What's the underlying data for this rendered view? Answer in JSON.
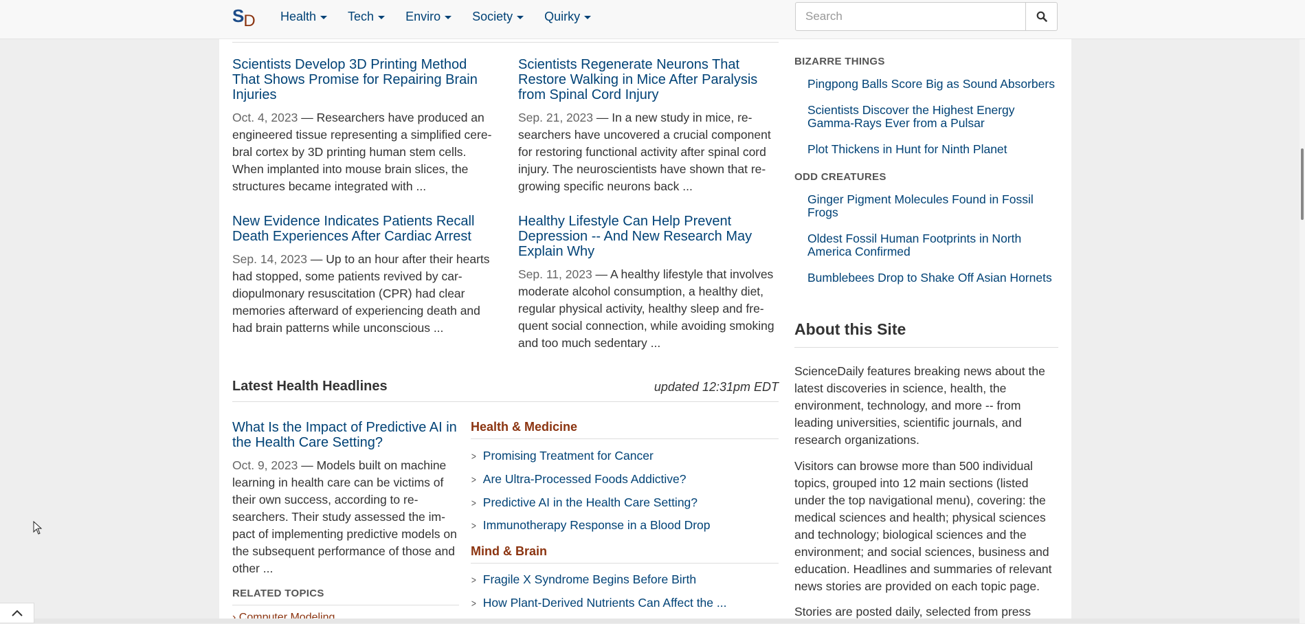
{
  "brand": {
    "s": "S",
    "d": "D"
  },
  "nav": [
    {
      "label": "Health"
    },
    {
      "label": "Tech"
    },
    {
      "label": "Enviro"
    },
    {
      "label": "Society"
    },
    {
      "label": "Quirky"
    }
  ],
  "search": {
    "placeholder": "Search",
    "icon": "search-icon"
  },
  "stories": [
    {
      "title": "Scientists Develop 3D Printing Method That Shows Promise for Repairing Brain Injuries",
      "date": "Oct. 4, 2023",
      "summary": "Researchers have produced an engineered tissue representing a simplified cere-bral cortex by 3D printing human stem cells. When implanted into mouse brain slices, the structures became integrated with ..."
    },
    {
      "title": "Scientists Regenerate Neurons That Restore Walking in Mice After Paralysis from Spinal Cord Injury",
      "date": "Sep. 21, 2023",
      "summary": "In a new study in mice, re-searchers have uncovered a crucial component for restoring functional activity after spinal cord injury. The neuroscientists have shown that re-growing specific neurons back ..."
    },
    {
      "title": "New Evidence Indicates Patients Recall Death Experiences After Cardiac Arrest",
      "date": "Sep. 14, 2023",
      "summary": "Up to an hour after their hearts had stopped, some patients revived by car-diopulmonary resuscitation (CPR) had clear memories afterward of experiencing death and had brain patterns while unconscious ..."
    },
    {
      "title": "Healthy Lifestyle Can Help Prevent Depression -- And New Research May Explain Why",
      "date": "Sep. 11, 2023",
      "summary": "A healthy lifestyle that involves moderate alcohol consumption, a healthy diet, regular physical activity, healthy sleep and fre-quent social connection, while avoiding smoking and too much sedentary ..."
    }
  ],
  "latest": {
    "heading": "Latest Health Headlines",
    "updated": "updated 12:31pm EDT",
    "feature": {
      "title": "What Is the Impact of Predictive AI in the Health Care Setting?",
      "date": "Oct. 9, 2023",
      "summary": "Models built on machine learning in health care can be victims of their own success, according to re-searchers. Their study assessed the im-pact of implementing predictive models on the subsequent performance of those and other ..."
    },
    "related_label": "RELATED TOPICS",
    "related_first": "Computer Modeling",
    "categories": [
      {
        "name": "Health & Medicine",
        "items": [
          "Promising Treatment for Cancer",
          "Are Ultra-Processed Foods Addictive?",
          "Predictive AI in the Health Care Setting?",
          "Immunotherapy Response in a Blood Drop"
        ]
      },
      {
        "name": "Mind & Brain",
        "items": [
          "Fragile X Syndrome Begins Before Birth",
          "How Plant-Derived Nutrients Can Affect the ..."
        ]
      }
    ]
  },
  "sidebar": {
    "bizarre_label": "BIZARRE THINGS",
    "bizarre": [
      "Pingpong Balls Score Big as Sound Absorbers",
      "Scientists Discover the Highest Energy Gamma-Rays Ever from a Pulsar",
      "Plot Thickens in Hunt for Ninth Planet"
    ],
    "odd_label": "ODD CREATURES",
    "odd": [
      "Ginger Pigment Molecules Found in Fossil Frogs",
      "Oldest Fossil Human Footprints in North America Confirmed",
      "Bumblebees Drop to Shake Off Asian Hornets"
    ],
    "about_heading": "About this Site",
    "about_p1": "ScienceDaily features breaking news about the latest discoveries in science, health, the environment, technology, and more -- from leading universities, scientific journals, and research organizations.",
    "about_p2": "Visitors can browse more than 500 individual topics, grouped into 12 main sections (listed under the top navigational menu), covering: the medical sciences and health; physical sciences and technology; biological sciences and the environment; and social sciences, business and education. Headlines and summaries of relevant news stories are provided on each topic page.",
    "about_p3": "Stories are posted daily, selected from press"
  },
  "colors": {
    "link": "#004276",
    "category": "#8b3410",
    "brand_s": "#1d4c88"
  }
}
